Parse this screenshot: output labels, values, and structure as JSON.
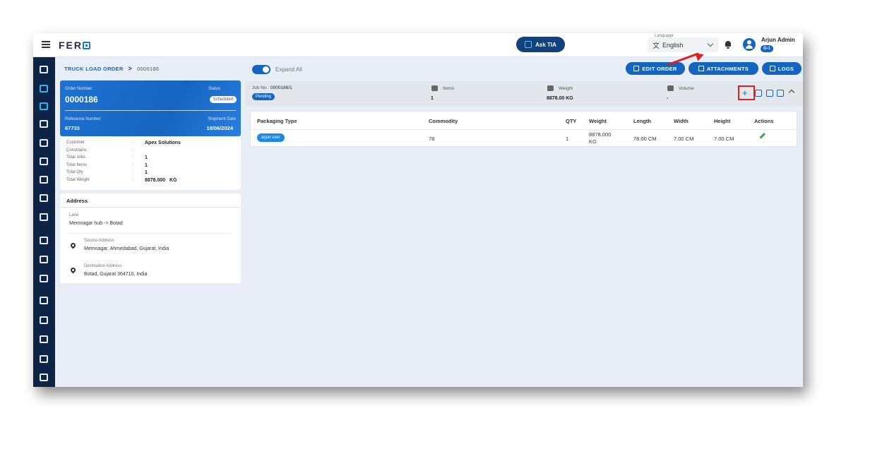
{
  "app": {
    "logo": "FER"
  },
  "header": {
    "ask_tia": "Ask TIA",
    "language_label": "Language",
    "language_value": "English",
    "user_name": "Arjun Admin",
    "user_badge": "G-1"
  },
  "breadcrumb": {
    "root": "TRUCK LOAD ORDER",
    "separator": ">",
    "current": "0000186"
  },
  "order": {
    "number_label": "Order Number",
    "number": "0000186",
    "status_label": "Status",
    "status": "Scheduled",
    "reference_label": "Reference Number",
    "reference": "67733",
    "shipment_label": "Shipment Date",
    "shipment_date": "18/06/2024"
  },
  "info": [
    {
      "key": "Customer",
      "value": "Apex Solutions"
    },
    {
      "key": "Constrains",
      "value": ""
    },
    {
      "key": "Total Jobs",
      "value": "1"
    },
    {
      "key": "Total Items",
      "value": "1"
    },
    {
      "key": "Total Qty",
      "value": "1"
    },
    {
      "key": "Total Weight",
      "value": "8878.000   KG"
    }
  ],
  "address": {
    "title": "Address",
    "lane_label": "Lane",
    "lane": "Memnagar hub -> Botad",
    "source_label": "Source Address",
    "source": "Memnagar, Ahmedabad, Gujarat, India",
    "destination_label": "Destination Address",
    "destination": "Botad, Gujarat 364710, India"
  },
  "toolbar": {
    "expand_all": "Expand All",
    "edit_order": "EDIT ORDER",
    "attachments": "ATTACHMENTS",
    "logs": "LOGS"
  },
  "job": {
    "job_no_label": "Job No :",
    "job_no": "0000186/1",
    "status": "Pending",
    "items_label": "Items",
    "items": "1",
    "weight_label": "Weight",
    "weight": "8878.00 KG",
    "volume_label": "Volume",
    "volume": "-"
  },
  "table": {
    "headers": [
      "Packaging Type",
      "Commodity",
      "QTY",
      "Weight",
      "Length",
      "Width",
      "Height",
      "Actions"
    ],
    "rows": [
      {
        "packaging": "arjun user",
        "commodity": "78",
        "qty": "1",
        "weight": "8878.000 KG",
        "length": "78.00 CM",
        "width": "7.00 CM",
        "height": "7.00 CM"
      }
    ]
  },
  "colors": {
    "primary": "#1565c0",
    "sidebar": "#0d2447",
    "highlight": "#e02020",
    "edit": "#43a047"
  }
}
